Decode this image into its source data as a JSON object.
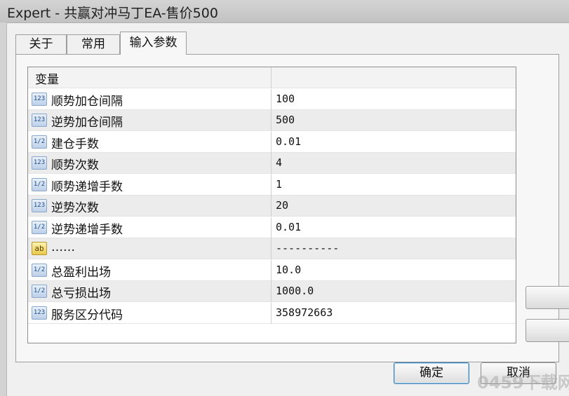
{
  "window": {
    "title": "Expert - 共赢对冲马丁EA-售价500"
  },
  "tabs": [
    {
      "label": "关于",
      "active": false
    },
    {
      "label": "常用",
      "active": false
    },
    {
      "label": "输入参数",
      "active": true
    }
  ],
  "params": {
    "header": {
      "name": "变量",
      "value": ""
    },
    "rows": [
      {
        "icon": "int-icon",
        "icon_text": "123",
        "name": "顺势加仓间隔",
        "value": "100"
      },
      {
        "icon": "int-icon",
        "icon_text": "123",
        "name": "逆势加仓间隔",
        "value": "500"
      },
      {
        "icon": "double-icon",
        "icon_text": "1/2",
        "name": "建仓手数",
        "value": "0.01"
      },
      {
        "icon": "int-icon",
        "icon_text": "123",
        "name": "顺势次数",
        "value": "4"
      },
      {
        "icon": "double-icon",
        "icon_text": "1/2",
        "name": "顺势递增手数",
        "value": "1"
      },
      {
        "icon": "int-icon",
        "icon_text": "123",
        "name": "逆势次数",
        "value": "20"
      },
      {
        "icon": "double-icon",
        "icon_text": "1/2",
        "name": "逆势递增手数",
        "value": "0.01"
      },
      {
        "icon": "string-icon",
        "icon_text": "ab",
        "name": "……",
        "value": "----------"
      },
      {
        "icon": "double-icon",
        "icon_text": "1/2",
        "name": "总盈利出场",
        "value": "10.0"
      },
      {
        "icon": "double-icon",
        "icon_text": "1/2",
        "name": "总亏损出场",
        "value": "1000.0"
      },
      {
        "icon": "int-icon",
        "icon_text": "123",
        "name": "服务区分代码",
        "value": "358972663"
      }
    ]
  },
  "buttons": {
    "ok": "确定",
    "cancel": "取消"
  },
  "watermark": "0459下载网"
}
